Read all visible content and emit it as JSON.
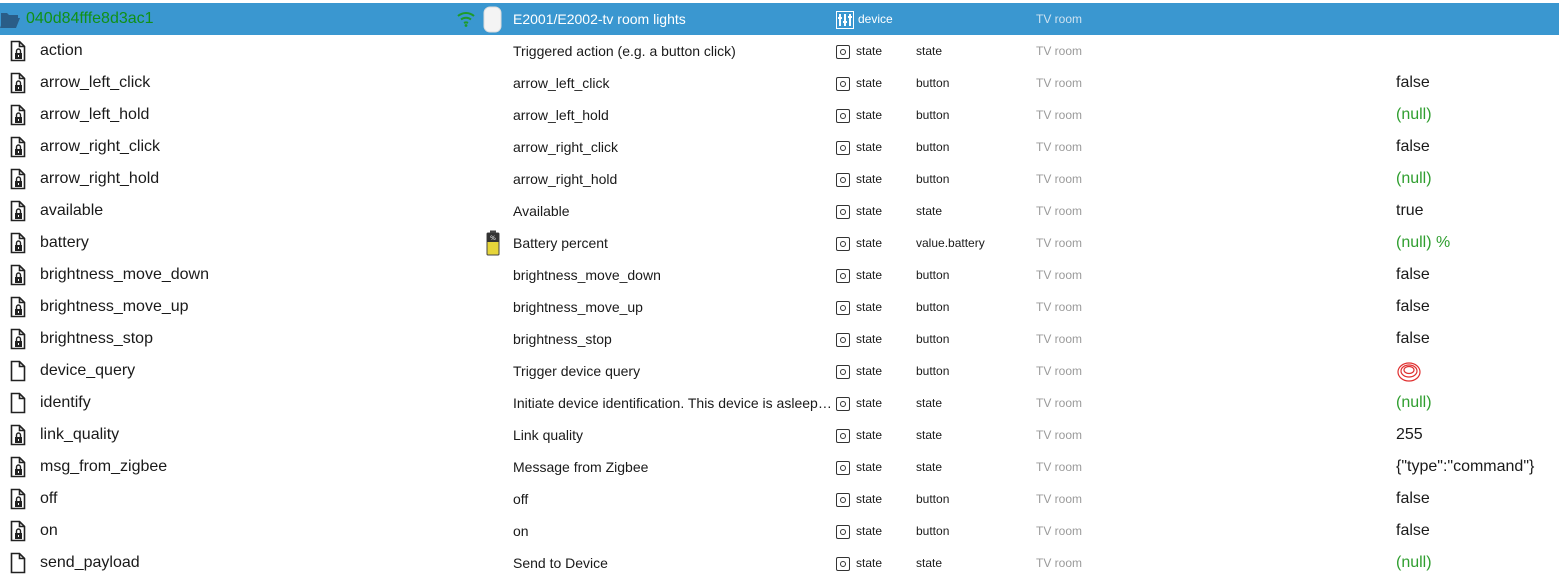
{
  "header": {
    "id": "040d84fffe8d3ac1",
    "device_name": "E2001/E2002-tv room lights",
    "type": "device",
    "room": "TV room",
    "icons": {
      "folder": "folder-open-icon",
      "signal": "wifi-signal-icon",
      "device": "device-image-icon",
      "type": "device-type-icon"
    }
  },
  "colors": {
    "header_bg": "#3a97d0",
    "id_text": "#109116",
    "null_value": "#2f9e2f",
    "room_text": "#9a9a9a",
    "button_value": "#e03030"
  },
  "rows": [
    {
      "name": "action",
      "description": "Triggered action (e.g. a button click)",
      "type": "state",
      "role": "state",
      "room": "TV room",
      "value": "",
      "locked": true
    },
    {
      "name": "arrow_left_click",
      "description": "arrow_left_click",
      "type": "state",
      "role": "button",
      "room": "TV room",
      "value": "false",
      "locked": true
    },
    {
      "name": "arrow_left_hold",
      "description": "arrow_left_hold",
      "type": "state",
      "role": "button",
      "room": "TV room",
      "value": "(null)",
      "locked": true
    },
    {
      "name": "arrow_right_click",
      "description": "arrow_right_click",
      "type": "state",
      "role": "button",
      "room": "TV room",
      "value": "false",
      "locked": true
    },
    {
      "name": "arrow_right_hold",
      "description": "arrow_right_hold",
      "type": "state",
      "role": "button",
      "room": "TV room",
      "value": "(null)",
      "locked": true
    },
    {
      "name": "available",
      "description": "Available",
      "type": "state",
      "role": "state",
      "room": "TV room",
      "value": "true",
      "locked": true
    },
    {
      "name": "battery",
      "description": "Battery percent",
      "type": "state",
      "role": "value.battery",
      "room": "TV room",
      "value": "(null) %",
      "locked": true,
      "role_icon": "battery-icon"
    },
    {
      "name": "brightness_move_down",
      "description": "brightness_move_down",
      "type": "state",
      "role": "button",
      "room": "TV room",
      "value": "false",
      "locked": true
    },
    {
      "name": "brightness_move_up",
      "description": "brightness_move_up",
      "type": "state",
      "role": "button",
      "room": "TV room",
      "value": "false",
      "locked": true
    },
    {
      "name": "brightness_stop",
      "description": "brightness_stop",
      "type": "state",
      "role": "button",
      "room": "TV room",
      "value": "false",
      "locked": true
    },
    {
      "name": "device_query",
      "description": "Trigger device query",
      "type": "state",
      "role": "button",
      "room": "TV room",
      "value": "",
      "locked": false,
      "value_icon": "push-button-icon"
    },
    {
      "name": "identify",
      "description": "Initiate device identification. This device is asleep by default.",
      "type": "state",
      "role": "state",
      "room": "TV room",
      "value": "(null)",
      "locked": false
    },
    {
      "name": "link_quality",
      "description": "Link quality",
      "type": "state",
      "role": "state",
      "room": "TV room",
      "value": "255",
      "locked": true
    },
    {
      "name": "msg_from_zigbee",
      "description": "Message from Zigbee",
      "type": "state",
      "role": "state",
      "room": "TV room",
      "value": "{\"type\":\"command\"}",
      "locked": true
    },
    {
      "name": "off",
      "description": "off",
      "type": "state",
      "role": "button",
      "room": "TV room",
      "value": "false",
      "locked": true
    },
    {
      "name": "on",
      "description": "on",
      "type": "state",
      "role": "button",
      "room": "TV room",
      "value": "false",
      "locked": true
    },
    {
      "name": "send_payload",
      "description": "Send to Device",
      "type": "state",
      "role": "state",
      "room": "TV room",
      "value": "(null)",
      "locked": false
    }
  ]
}
